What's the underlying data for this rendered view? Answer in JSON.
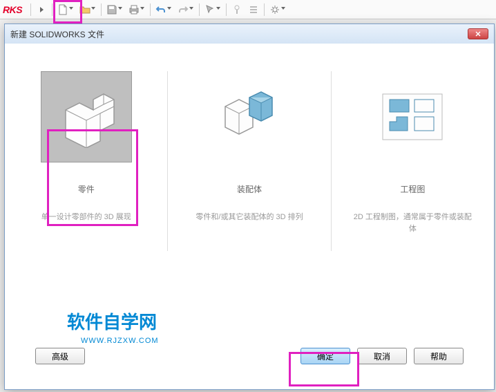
{
  "app": {
    "logo": "RKS"
  },
  "dialog": {
    "title": "新建 SOLIDWORKS 文件",
    "options": [
      {
        "title": "零件",
        "desc": "单一设计零部件的 3D 展现"
      },
      {
        "title": "装配体",
        "desc": "零件和/或其它装配体的 3D 排列"
      },
      {
        "title": "工程图",
        "desc": "2D 工程制图，通常属于零件或装配体"
      }
    ],
    "buttons": {
      "advanced": "高级",
      "ok": "确定",
      "cancel": "取消",
      "help": "帮助"
    }
  },
  "watermark": {
    "main": "软件自学网",
    "sub": "WWW.RJZXW.COM"
  }
}
